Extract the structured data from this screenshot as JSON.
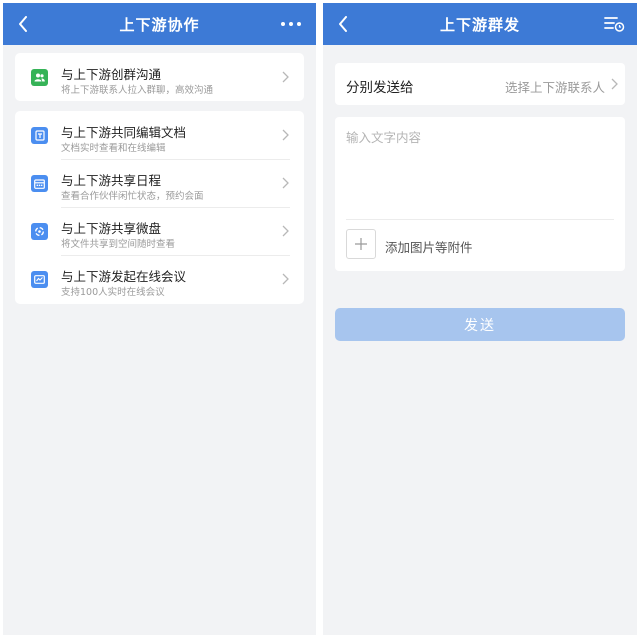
{
  "left": {
    "title": "上下游协作",
    "group1": [
      {
        "title": "与上下游创群沟通",
        "subtitle": "将上下游联系人拉入群聊，高效沟通",
        "icon": "group-chat-icon",
        "color": "#36b357"
      }
    ],
    "group2": [
      {
        "title": "与上下游共同编辑文档",
        "subtitle": "文档实时查看和在线编辑",
        "icon": "document-icon",
        "color": "#4b8ef0"
      },
      {
        "title": "与上下游共享日程",
        "subtitle": "查看合作伙伴闲忙状态，预约会面",
        "icon": "calendar-icon",
        "color": "#4b8ef0"
      },
      {
        "title": "与上下游共享微盘",
        "subtitle": "将文件共享到空间随时查看",
        "icon": "cloud-disk-icon",
        "color": "#4b8ef0"
      },
      {
        "title": "与上下游发起在线会议",
        "subtitle": "支持100人实时在线会议",
        "icon": "meeting-icon",
        "color": "#4b8ef0"
      }
    ]
  },
  "right": {
    "title": "上下游群发",
    "send_to_label": "分别发送给",
    "send_to_value": "选择上下游联系人",
    "message_placeholder": "输入文字内容",
    "attach_label": "添加图片等附件",
    "send_button": "发送"
  },
  "colors": {
    "header": "#3d7ad6",
    "send_button_disabled": "#a7c5ee",
    "background": "#f2f3f5"
  }
}
